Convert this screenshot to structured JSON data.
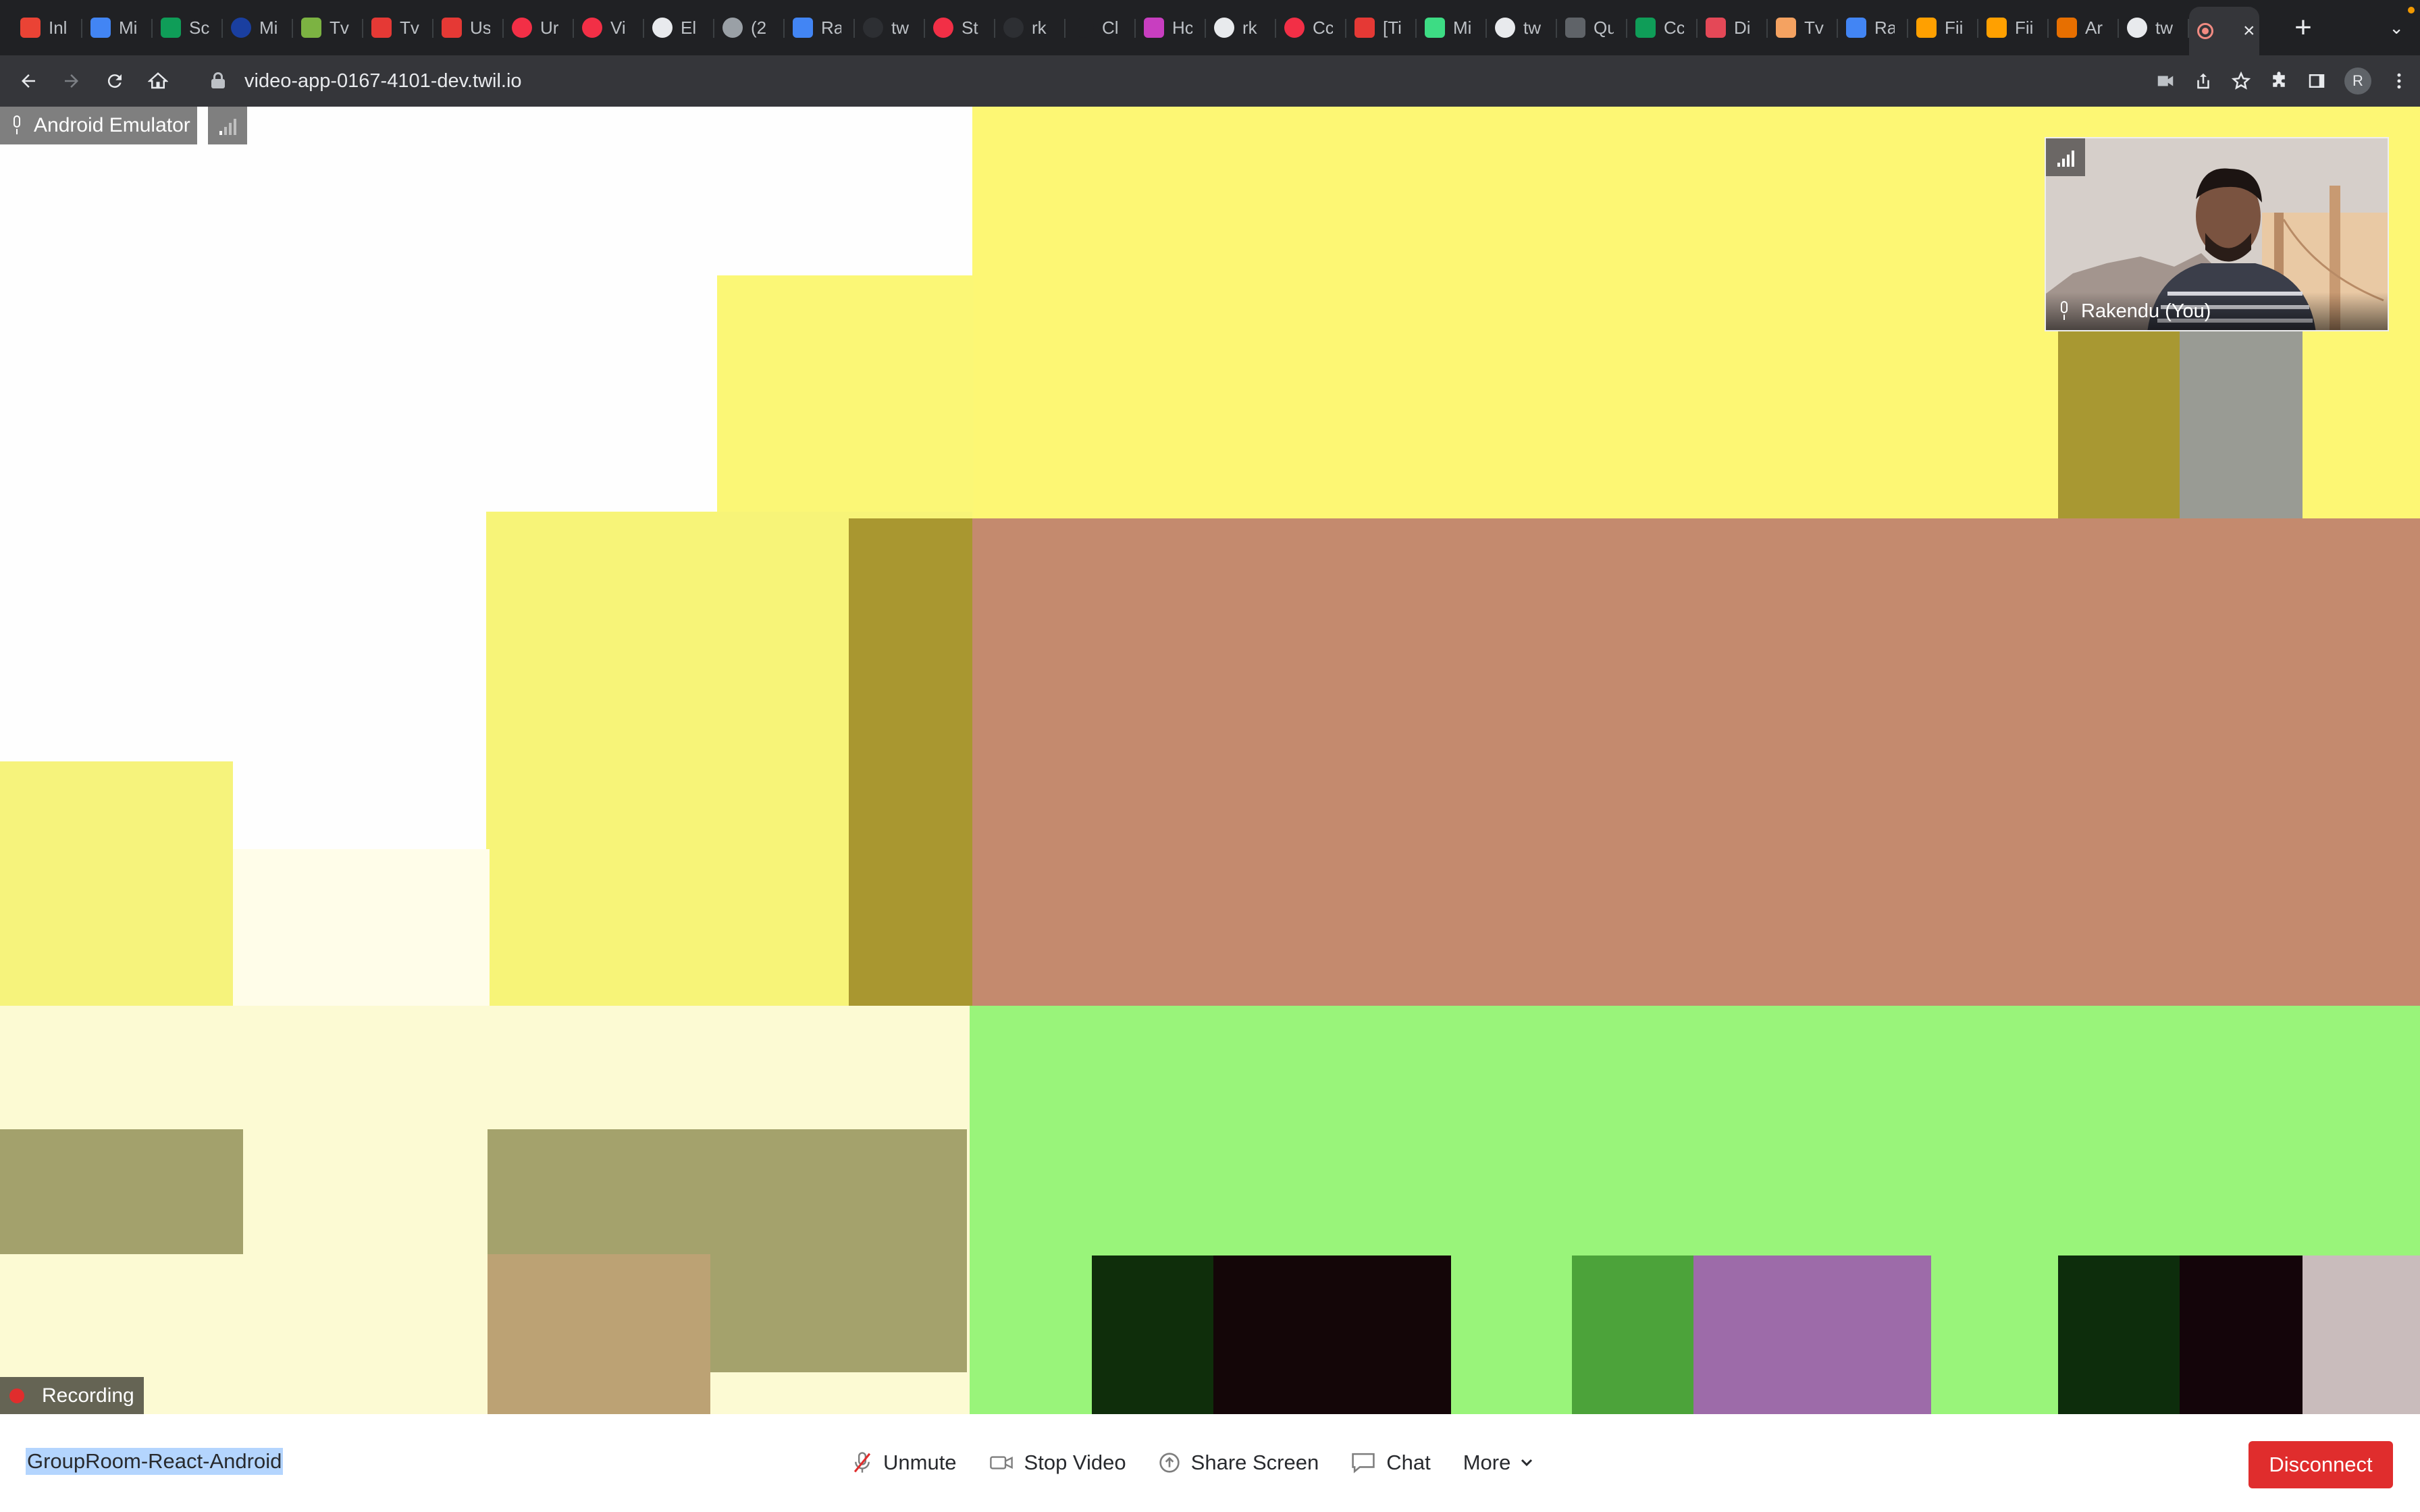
{
  "browser": {
    "tabs": [
      {
        "label": "Inl",
        "icon": "gmail-icon",
        "color": "#ea4335"
      },
      {
        "label": "Mi",
        "icon": "docs-icon",
        "color": "#4285f4"
      },
      {
        "label": "Sc",
        "icon": "sheets-icon",
        "color": "#0f9d58"
      },
      {
        "label": "Mi",
        "icon": "blue-circle-icon",
        "color": "#1a3fa0"
      },
      {
        "label": "Tv",
        "icon": "leaf-icon",
        "color": "#7cb342"
      },
      {
        "label": "Tv",
        "icon": "search-red-icon",
        "color": "#e53935"
      },
      {
        "label": "Us",
        "icon": "x-red-icon",
        "color": "#e53935"
      },
      {
        "label": "Ur",
        "icon": "twilio-icon",
        "color": "#f22f46"
      },
      {
        "label": "Vi",
        "icon": "twilio-icon",
        "color": "#f22f46"
      },
      {
        "label": "El",
        "icon": "globe-icon",
        "color": "#e8eaed"
      },
      {
        "label": "(2",
        "icon": "avatar-icon",
        "color": "#9aa0a6"
      },
      {
        "label": "Ra",
        "icon": "docs-icon",
        "color": "#4285f4"
      },
      {
        "label": "tw",
        "icon": "dark-circle-icon",
        "color": "#2d2f33"
      },
      {
        "label": "St",
        "icon": "twilio-icon",
        "color": "#f22f46"
      },
      {
        "label": "rk",
        "icon": "dark-circle-icon",
        "color": "#2d2f33"
      },
      {
        "label": "Cl",
        "icon": "github-icon",
        "color": "#202124"
      },
      {
        "label": "Hc",
        "icon": "hackerrank-icon",
        "color": "#c83ec0"
      },
      {
        "label": "rk",
        "icon": "github-icon",
        "color": "#e8eaed"
      },
      {
        "label": "Cc",
        "icon": "twilio-icon",
        "color": "#f22f46"
      },
      {
        "label": "[Ti",
        "icon": "x-red-icon",
        "color": "#e53935"
      },
      {
        "label": "Mi",
        "icon": "android-icon",
        "color": "#3ddc84"
      },
      {
        "label": "tw",
        "icon": "github-icon",
        "color": "#e8eaed"
      },
      {
        "label": "Qu",
        "icon": "gear-icon",
        "color": "#5f6368"
      },
      {
        "label": "Cc",
        "icon": "sheets-icon",
        "color": "#0f9d58"
      },
      {
        "label": "Di",
        "icon": "kotlin-icon",
        "color": "#e44857"
      },
      {
        "label": "Tv",
        "icon": "tree-icon",
        "color": "#f4a261"
      },
      {
        "label": "Ra",
        "icon": "docs-icon",
        "color": "#4285f4"
      },
      {
        "label": "Fii",
        "icon": "firebase-icon",
        "color": "#ffa000"
      },
      {
        "label": "Fii",
        "icon": "firebase-icon",
        "color": "#ffa000"
      },
      {
        "label": "Ar",
        "icon": "java-icon",
        "color": "#e76f00"
      },
      {
        "label": "tw",
        "icon": "github-icon",
        "color": "#e8eaed"
      },
      {
        "label": "",
        "icon": "recording-tab-icon",
        "color": "#f28b82",
        "active": true
      }
    ],
    "new_tab": "+",
    "url": "video-app-0167-4101-dev.twil.io",
    "profile_initial": "R"
  },
  "video": {
    "main_participant": "Android Emulator",
    "self_view_name": "Rakendu (You)",
    "recording_label": "Recording"
  },
  "menu": {
    "room_name": "GroupRoom-React-Android",
    "unmute": "Unmute",
    "stop_video": "Stop Video",
    "share_screen": "Share Screen",
    "chat": "Chat",
    "more": "More",
    "disconnect": "Disconnect"
  },
  "colors": {
    "accent_red": "#e02d2d",
    "selection": "#b4d5fe"
  }
}
